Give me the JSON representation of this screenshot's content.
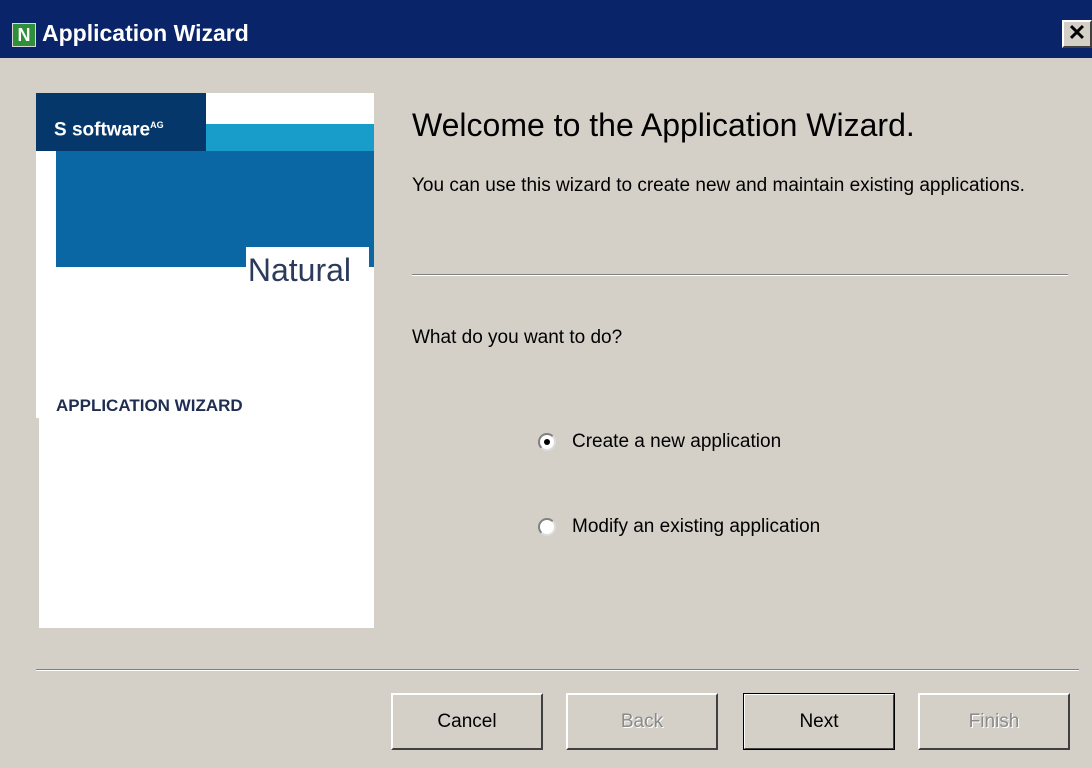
{
  "window": {
    "title": "Application Wizard",
    "app_icon_letter": "N",
    "close_glyph": "✕"
  },
  "branding": {
    "logo_text": "software",
    "logo_superscript": "AG",
    "logo_mark": "S",
    "product_name": "Natural",
    "panel_label": "APPLICATION WIZARD",
    "colors": {
      "dark_blue": "#05376b",
      "mid_blue": "#0b67a4",
      "cyan": "#189dcb"
    }
  },
  "content": {
    "heading": "Welcome to the Application Wizard.",
    "intro": "You can use this wizard to create new and maintain existing applications.",
    "question": "What do you want to do?",
    "options": [
      {
        "label": "Create a new application",
        "selected": true
      },
      {
        "label": "Modify an existing application",
        "selected": false
      }
    ]
  },
  "buttons": {
    "cancel": "Cancel",
    "back": "Back",
    "next": "Next",
    "finish": "Finish"
  },
  "colors": {
    "titlebar": "#0a246a",
    "dialog_bg": "#d4d0c8"
  }
}
